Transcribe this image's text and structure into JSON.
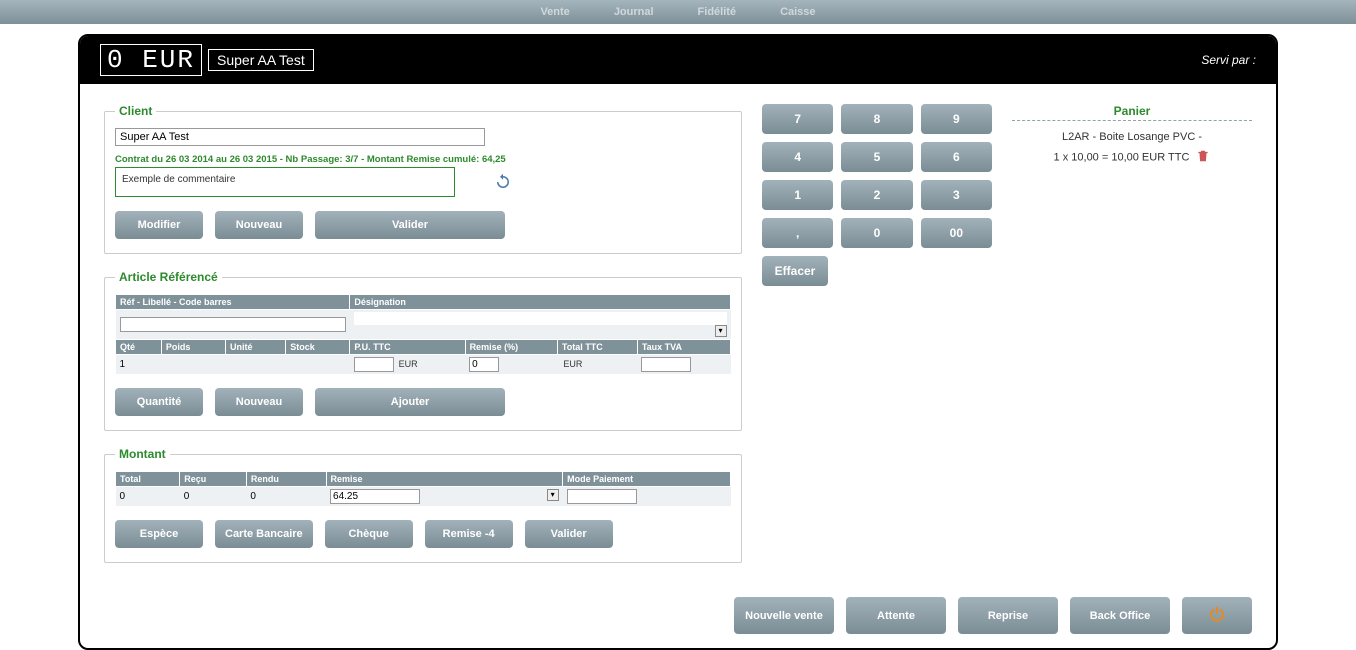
{
  "nav": {
    "vente": "Vente",
    "journal": "Journal",
    "fidelite": "Fidélité",
    "caisse": "Caisse"
  },
  "header": {
    "led": "0 EUR",
    "title": "Super AA Test",
    "served_by": "Servi par :"
  },
  "client": {
    "legend": "Client",
    "value": "Super AA Test",
    "contrat": "Contrat du 26 03 2014 au 26 03 2015 - Nb Passage: 3/7 - Montant Remise cumulé: 64,25",
    "comment": "Exemple de commentaire",
    "btn_modifier": "Modifier",
    "btn_nouveau": "Nouveau",
    "btn_valider": "Valider"
  },
  "article": {
    "legend": "Article Référencé",
    "h_ref": "Réf - Libellé - Code barres",
    "h_designation": "Désignation",
    "h_qte": "Qté",
    "h_poids": "Poids",
    "h_unite": "Unité",
    "h_stock": "Stock",
    "h_pu": "P.U. TTC",
    "h_remise": "Remise (%)",
    "h_totalttc": "Total TTC",
    "h_tauxtva": "Taux TVA",
    "qte_val": "1",
    "pu_val": "",
    "rem_val": "0",
    "eur": "EUR",
    "btn_quantite": "Quantité",
    "btn_nouveau": "Nouveau",
    "btn_ajouter": "Ajouter"
  },
  "montant": {
    "legend": "Montant",
    "h_total": "Total",
    "h_recu": "Reçu",
    "h_rendu": "Rendu",
    "h_remise": "Remise",
    "h_mode": "Mode Paiement",
    "total_val": "0",
    "recu_val": "0",
    "rendu_val": "0",
    "remise_val": "64.25",
    "btn_espece": "Espèce",
    "btn_cb": "Carte Bancaire",
    "btn_cheque": "Chèque",
    "btn_remise": "Remise -4",
    "btn_valider": "Valider"
  },
  "keypad": {
    "k7": "7",
    "k8": "8",
    "k9": "9",
    "k4": "4",
    "k5": "5",
    "k6": "6",
    "k1": "1",
    "k2": "2",
    "k3": "3",
    "kcomma": ",",
    "k0": "0",
    "k00": "00",
    "clear": "Effacer"
  },
  "cart": {
    "title": "Panier",
    "line1": "L2AR - Boite Losange PVC -",
    "line2": "1 x 10,00 = 10,00 EUR TTC"
  },
  "footer": {
    "nouvelle": "Nouvelle vente",
    "attente": "Attente",
    "reprise": "Reprise",
    "backoffice": "Back Office"
  }
}
